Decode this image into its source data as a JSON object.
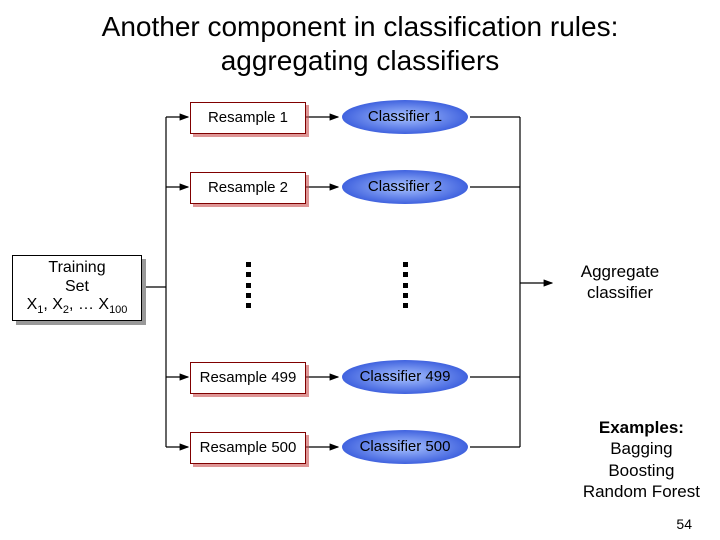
{
  "title": {
    "line1": "Another component in classification rules:",
    "line2": "aggregating classifiers"
  },
  "training": {
    "line1": "Training",
    "line2": "Set",
    "line3_prefix": "X",
    "line3_sub1": "1",
    "line3_mid": ", X",
    "line3_sub2": "2",
    "line3_mid2": ", … X",
    "line3_sub3": "100"
  },
  "resamples": {
    "r1": "Resample 1",
    "r2": "Resample 2",
    "r3": "Resample 499",
    "r4": "Resample 500"
  },
  "classifiers": {
    "c1": "Classifier 1",
    "c2": "Classifier 2",
    "c3": "Classifier 499",
    "c4": "Classifier 500"
  },
  "aggregate": {
    "line1": "Aggregate",
    "line2": "classifier"
  },
  "examples": {
    "header": "Examples:",
    "e1": "Bagging",
    "e2": "Boosting",
    "e3": "Random Forest"
  },
  "page": "54"
}
